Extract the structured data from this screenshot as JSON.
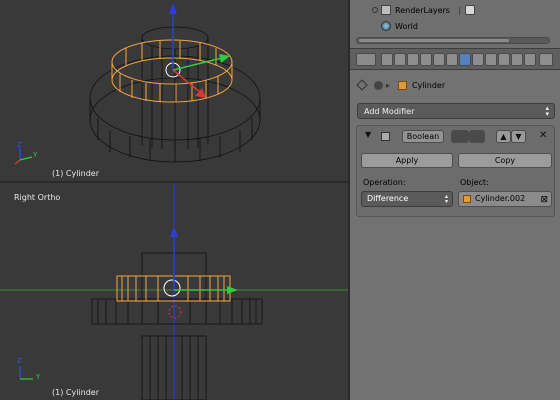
{
  "viewport_top": {
    "object_label": "(1) Cylinder",
    "axis_y": "Y",
    "axis_z": "Z"
  },
  "viewport_bottom": {
    "view_name": "Right Ortho",
    "object_label": "(1) Cylinder",
    "axis_y": "Y",
    "axis_z": "Z"
  },
  "outliner": {
    "items": [
      {
        "label": "RenderLayers",
        "icon": "render-layers-icon"
      },
      {
        "label": "World",
        "icon": "world-icon"
      }
    ]
  },
  "properties": {
    "breadcrumb_object": "Cylinder",
    "add_modifier_label": "Add Modifier",
    "modifier": {
      "name": "Boolean",
      "apply_label": "Apply",
      "copy_label": "Copy",
      "operation_label": "Operation:",
      "operation_value": "Difference",
      "object_label": "Object:",
      "object_value": "Cylinder.002"
    }
  },
  "colors": {
    "viewport_bg": "#393939",
    "panel_bg": "#727272",
    "selection": "#f2a541",
    "wire": "#000000",
    "axis_x": "#d23a3a",
    "axis_y": "#2ecc40",
    "axis_z": "#3050e0",
    "active_tab": "#5680c2"
  }
}
